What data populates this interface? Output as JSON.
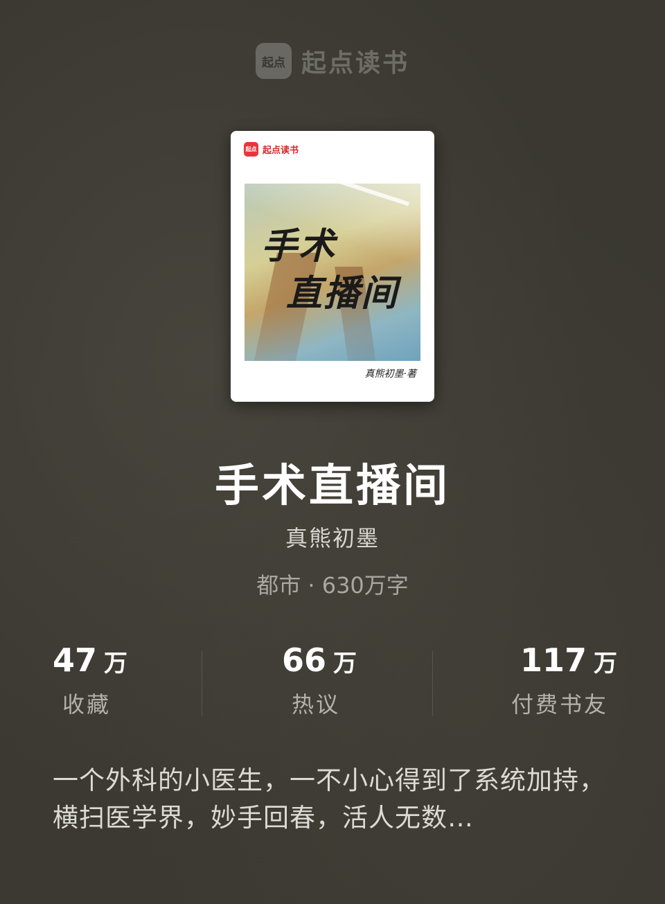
{
  "brand": {
    "logo_text": "起点",
    "name": "起点读书"
  },
  "cover": {
    "brand_logo_text": "起点",
    "brand_name": "起点读书",
    "title_line1": "手术",
    "title_line2": "直播间",
    "author_sign": "真熊初墨·著"
  },
  "book": {
    "title": "手术直播间",
    "author": "真熊初墨",
    "meta": "都市 · 630万字"
  },
  "stats": [
    {
      "value": "47",
      "unit": "万",
      "label": "收藏"
    },
    {
      "value": "66",
      "unit": "万",
      "label": "热议"
    },
    {
      "value": "117",
      "unit": "万",
      "label": "付费书友"
    }
  ],
  "description": "一个外科的小医生，一不小心得到了系统加持，横扫医学界，妙手回春，活人无数…"
}
